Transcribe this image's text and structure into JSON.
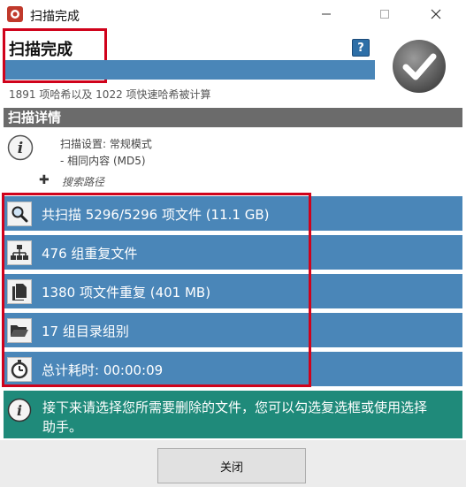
{
  "window": {
    "title": "扫描完成",
    "controls": {
      "minimize": "—",
      "maximize": "☐",
      "close": "✕"
    }
  },
  "header": {
    "title": "扫描完成",
    "help_icon": "?",
    "progress_fraction": 1.0,
    "hash_summary": "1891 项哈希以及 1022 项快速哈希被计算"
  },
  "details": {
    "section_title": "扫描详情",
    "settings_line_1": "扫描设置: 常规模式",
    "settings_line_2": "- 相同内容 (MD5)",
    "search_path_label": "搜索路径",
    "rows": [
      {
        "icon": "magnifier-icon",
        "text": "共扫描 5296/5296 项文件 (11.1 GB)"
      },
      {
        "icon": "hierarchy-icon",
        "text": "476 组重复文件"
      },
      {
        "icon": "document-icon",
        "text": "1380 项文件重复 (401 MB)"
      },
      {
        "icon": "folder-icon",
        "text": "17 组目录组别"
      },
      {
        "icon": "stopwatch-icon",
        "text": "总计耗时: 00:00:09"
      }
    ]
  },
  "note": {
    "text": "接下来请选择您所需要删除的文件，您可以勾选复选框或使用选择助手。"
  },
  "footer": {
    "close_label": "关闭"
  },
  "colors": {
    "row_blue": "#4a86b8",
    "note_teal": "#1f8a7a",
    "section_gray": "#6b6b6b",
    "highlight_red": "#d0021b"
  }
}
